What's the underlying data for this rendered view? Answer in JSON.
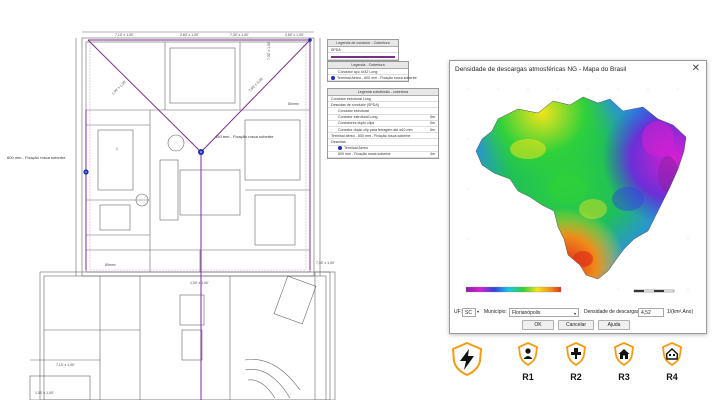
{
  "cad": {
    "dims": [
      "7,10' x 1,00'",
      "2,60' x 1,00'",
      "7,30' x 1,00'",
      "2,60' x 1,00'",
      "7,32' x 1,00'",
      "1,00' x 1,00'",
      "7,80' x 3,00'",
      "1,00' x 1,00'"
    ],
    "label_left": "600 mm - Fixação rosca soberbe",
    "label_center": "450 mm - Fixação rosca soberbe",
    "legend_a": {
      "header": "Legenda de condutor - Cobertura",
      "rows": [
        "SPDA"
      ]
    },
    "legend_b": {
      "header": "Legenda - Cobertura",
      "rows": [
        "Condutor aço 4x32 Long",
        "Terminal Aéreo - 600 mm - Fixação rosca soberbe"
      ]
    },
    "legend_c": {
      "header": "Legenda subdivisão - cobertura",
      "rows": [
        "Condutor estrutural Long",
        "Descidas de condutor (SPDA)",
        "Condutor estrutural",
        "Conector estrutural Long",
        "Conectores duplo clips",
        "Conector duplo clip para ferragem até ø10 mm",
        "Terminal aéreo - 600 mm - Fixação rosca soberbe",
        "Descidas",
        "Terminal Aéreo",
        "600 mm - Fixação rosca soberbe"
      ],
      "counts": [
        "",
        "",
        "",
        "5m",
        "5m",
        "5m",
        "",
        "",
        "",
        "4m"
      ]
    }
  },
  "dialog": {
    "title": "Densidade de descargas atmosféricas NG - Mapa do Brasil",
    "close_symbol": "✕",
    "uf_label": "UF:",
    "uf_value": "SC",
    "municipio_label": "Município:",
    "municipio_value": "Florianópolis",
    "densidade_label": "Densidade de descargas:",
    "densidade_value": "4,52",
    "unit": "1/(km².Ano)",
    "ok_label": "OK",
    "cancel_label": "Cancelar",
    "help_label": "Ajuda"
  },
  "risk_icons": [
    {
      "icon": "lightning-icon",
      "label": ""
    },
    {
      "icon": "person-icon",
      "label": "R1"
    },
    {
      "icon": "utility-icon",
      "label": "R2"
    },
    {
      "icon": "house-icon",
      "label": "R3"
    },
    {
      "icon": "building-icon",
      "label": "R4"
    }
  ],
  "colors": {
    "accent": "#f39c12",
    "spda_line": "#7b2f8a",
    "terminal": "#1c2fb5"
  }
}
